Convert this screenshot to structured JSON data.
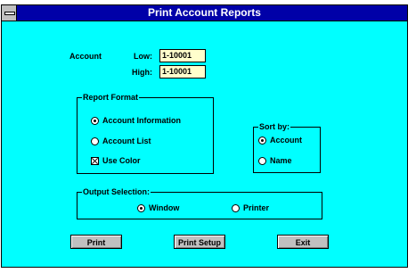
{
  "window": {
    "title": "Print Account Reports"
  },
  "account": {
    "label": "Account",
    "low_label": "Low:",
    "low_value": "1-10001",
    "high_label": "High:",
    "high_value": "1-10001"
  },
  "report_format": {
    "legend": "Report Format",
    "options": [
      {
        "label": "Account Information",
        "selected": true
      },
      {
        "label": "Account List",
        "selected": false
      }
    ],
    "use_color": {
      "label": "Use Color",
      "checked": true
    }
  },
  "sort_by": {
    "legend": "Sort by:",
    "options": [
      {
        "label": "Account",
        "selected": true
      },
      {
        "label": "Name",
        "selected": false
      }
    ]
  },
  "output_selection": {
    "legend": "Output Selection:",
    "options": [
      {
        "label": "Window",
        "selected": true
      },
      {
        "label": "Printer",
        "selected": false
      }
    ]
  },
  "buttons": {
    "print": "Print",
    "print_setup": "Print Setup",
    "exit": "Exit"
  }
}
